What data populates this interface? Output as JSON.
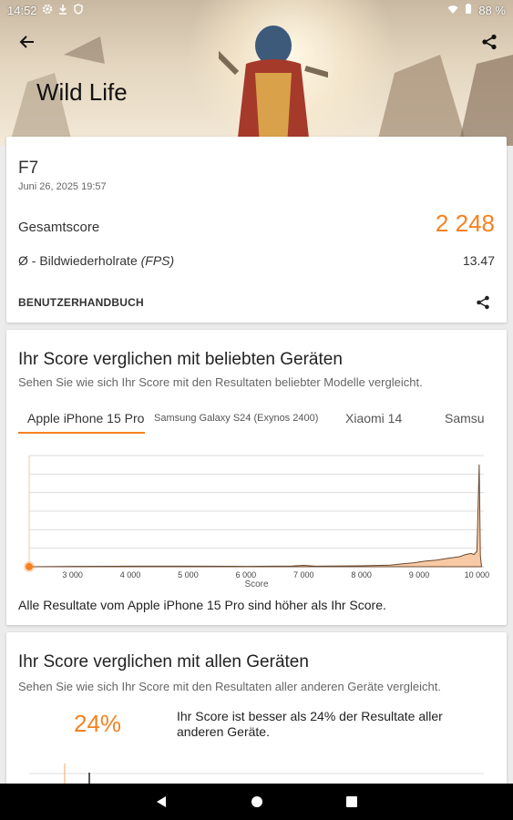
{
  "status_bar": {
    "time": "14:52",
    "battery": "88 %",
    "icons": [
      "settings-icon",
      "download-icon",
      "shield-icon",
      "wifi-icon",
      "battery-icon"
    ]
  },
  "header": {
    "title": "Wild Life"
  },
  "result_card": {
    "device": "F7",
    "date": "Juni 26, 2025 19:57",
    "score_label": "Gesamtscore",
    "score_value": "2 248",
    "fps_label_prefix": "Ø - Bildwiederholrate ",
    "fps_label_unit": "(FPS)",
    "fps_value": "13.47",
    "manual_label": "BENUTZERHANDBUCH"
  },
  "popular_card": {
    "title": "Ihr Score verglichen mit beliebten Geräten",
    "subtitle": "Sehen Sie wie sich Ihr Score mit den Resultaten beliebter Modelle vergleicht.",
    "tabs": [
      {
        "label": "Apple iPhone 15 Pro"
      },
      {
        "label": "Samsung Galaxy S24 (Exynos 2400)"
      },
      {
        "label": "Xiaomi 14"
      },
      {
        "label": "Samsu"
      }
    ],
    "footer": "Alle Resultate vom Apple iPhone 15 Pro sind höher als Ihr Score."
  },
  "all_card": {
    "title": "Ihr Score verglichen mit allen Geräten",
    "subtitle": "Sehen Sie wie sich Ihr Score mit den Resultaten aller anderen Geräte vergleicht.",
    "percent": "24%",
    "description": "Ihr Score ist besser als 24% der Resultate aller anderen Geräte."
  },
  "colors": {
    "accent": "#f58220"
  },
  "chart_data": {
    "type": "area",
    "xlabel": "Score",
    "ylabel": "",
    "xlim": [
      2248,
      10120
    ],
    "x_ticks": [
      "3 000",
      "4 000",
      "5 000",
      "6 000",
      "7 000",
      "8 000",
      "9 000",
      "10 000"
    ],
    "x_tick_values": [
      3000,
      4000,
      5000,
      6000,
      7000,
      8000,
      9000,
      10000
    ],
    "your_score": 2248,
    "grid": true,
    "ylim": [
      0,
      100
    ],
    "series": [
      {
        "x": [
          2300,
          3000,
          4000,
          5000,
          6000,
          6800,
          7000,
          7200,
          7500,
          8000,
          8500,
          8700,
          8900,
          9100,
          9300,
          9500,
          9700,
          9800,
          9900,
          9950,
          10000,
          10040,
          10060,
          10080
        ],
        "y": [
          0,
          0.3,
          0.5,
          0.5,
          0.3,
          0.6,
          1.2,
          0.5,
          0.6,
          0.8,
          1.5,
          2.5,
          3.5,
          5,
          6,
          7.5,
          9,
          11,
          12,
          11,
          14,
          92,
          10,
          0
        ]
      }
    ]
  }
}
